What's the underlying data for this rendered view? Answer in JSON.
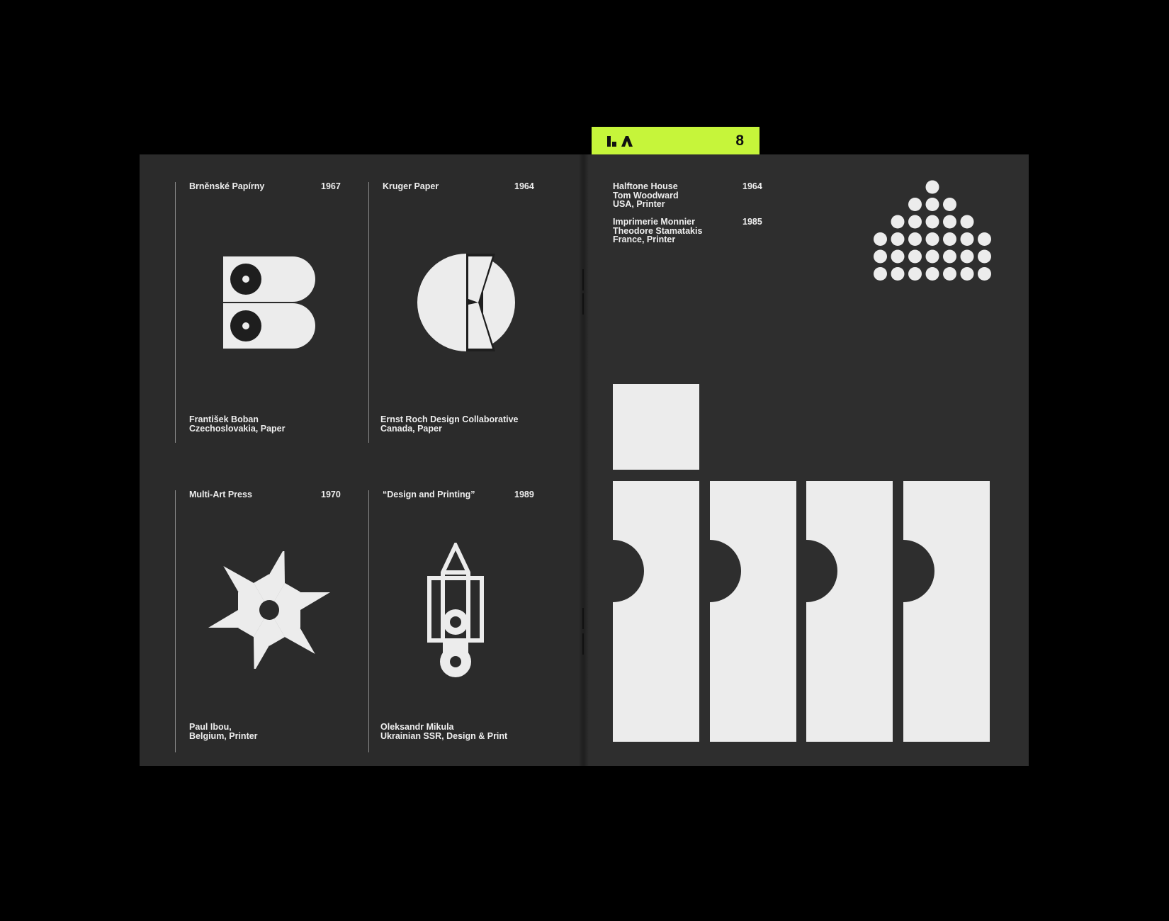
{
  "tab": {
    "page_number": "8",
    "logo": "la-monogram-icon",
    "color": "#c6f53a"
  },
  "left_page": {
    "entries": [
      {
        "name": "Brněnské Papírny",
        "year": "1967",
        "designer": "František Boban",
        "origin": "Czechoslovakia, Paper",
        "logo": "double-b-circle-logo"
      },
      {
        "name": "Kruger Paper",
        "year": "1964",
        "designer": "Ernst Roch Design Collaborative",
        "origin": "Canada, Paper",
        "logo": "k-circle-logo"
      },
      {
        "name": "Multi-Art Press",
        "year": "1970",
        "designer": "Paul Ibou,",
        "origin": "Belgium, Printer",
        "logo": "pinwheel-star-logo"
      },
      {
        "name": "“Design and Printing”",
        "year": "1989",
        "designer": "Oleksandr Mikula",
        "origin": "Ukrainian SSR, Design & Print",
        "logo": "pencil-roller-logo"
      }
    ]
  },
  "right_page": {
    "entries": [
      {
        "name": "Halftone House",
        "year": "1964",
        "designer": "Tom Woodward",
        "origin": "USA, Printer",
        "logo": "halftone-dots-logo"
      },
      {
        "name": "Imprimerie Monnier",
        "year": "1985",
        "designer": "Theodore Stamatakis",
        "origin": "France, Printer",
        "logo": "imm-bars-logo"
      }
    ]
  }
}
